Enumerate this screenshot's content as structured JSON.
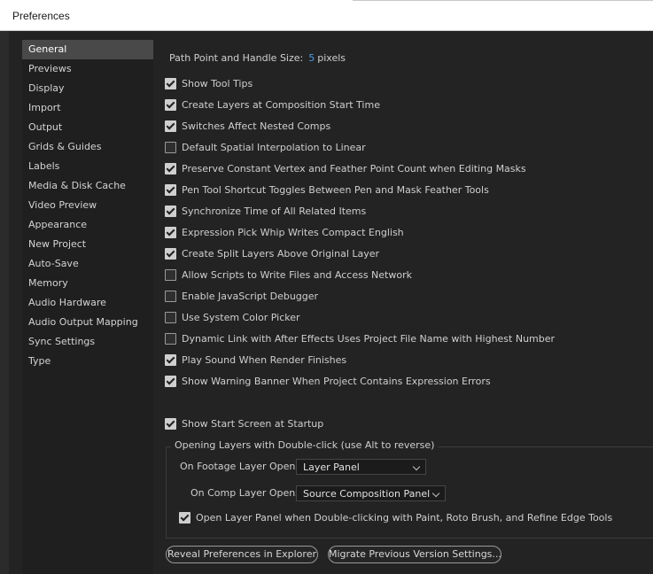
{
  "window": {
    "title": "Preferences"
  },
  "sidebar": {
    "items": [
      {
        "label": "General",
        "selected": true
      },
      {
        "label": "Previews"
      },
      {
        "label": "Display"
      },
      {
        "label": "Import"
      },
      {
        "label": "Output"
      },
      {
        "label": "Grids & Guides"
      },
      {
        "label": "Labels"
      },
      {
        "label": "Media & Disk Cache"
      },
      {
        "label": "Video Preview"
      },
      {
        "label": "Appearance"
      },
      {
        "label": "New Project"
      },
      {
        "label": "Auto-Save"
      },
      {
        "label": "Memory"
      },
      {
        "label": "Audio Hardware"
      },
      {
        "label": "Audio Output Mapping"
      },
      {
        "label": "Sync Settings"
      },
      {
        "label": "Type"
      }
    ]
  },
  "general": {
    "path_point": {
      "label": "Path Point and Handle Size:",
      "value": "5",
      "unit": "pixels"
    },
    "options": [
      {
        "label": "Show Tool Tips",
        "checked": true
      },
      {
        "label": "Create Layers at Composition Start Time",
        "checked": true
      },
      {
        "label": "Switches Affect Nested Comps",
        "checked": true
      },
      {
        "label": "Default Spatial Interpolation to Linear",
        "checked": false
      },
      {
        "label": "Preserve Constant Vertex and Feather Point Count when Editing Masks",
        "checked": true
      },
      {
        "label": "Pen Tool Shortcut Toggles Between Pen and Mask Feather Tools",
        "checked": true
      },
      {
        "label": "Synchronize Time of All Related Items",
        "checked": true
      },
      {
        "label": "Expression Pick Whip Writes Compact English",
        "checked": true
      },
      {
        "label": "Create Split Layers Above Original Layer",
        "checked": true
      },
      {
        "label": "Allow Scripts to Write Files and Access Network",
        "checked": false
      },
      {
        "label": "Enable JavaScript Debugger",
        "checked": false
      },
      {
        "label": "Use System Color Picker",
        "checked": false
      },
      {
        "label": "Dynamic Link with After Effects Uses Project File Name with Highest Number",
        "checked": false
      },
      {
        "label": "Play Sound When Render Finishes",
        "checked": true
      },
      {
        "label": "Show Warning Banner When Project Contains Expression Errors",
        "checked": true
      }
    ],
    "start_screen": {
      "label": "Show Start Screen at Startup",
      "checked": true
    },
    "opening_layers": {
      "legend": "Opening Layers with Double-click (use Alt to reverse)",
      "footage_label": "On Footage Layer Opens:",
      "footage_value": "Layer Panel",
      "comp_label": "On Comp Layer Opens:",
      "comp_value": "Source Composition Panel",
      "paint_option": {
        "label": "Open Layer Panel when Double-clicking with Paint, Roto Brush, and Refine Edge Tools",
        "checked": true
      }
    },
    "buttons": {
      "reveal": "Reveal Preferences in Explorer",
      "migrate": "Migrate Previous Version Settings..."
    }
  }
}
